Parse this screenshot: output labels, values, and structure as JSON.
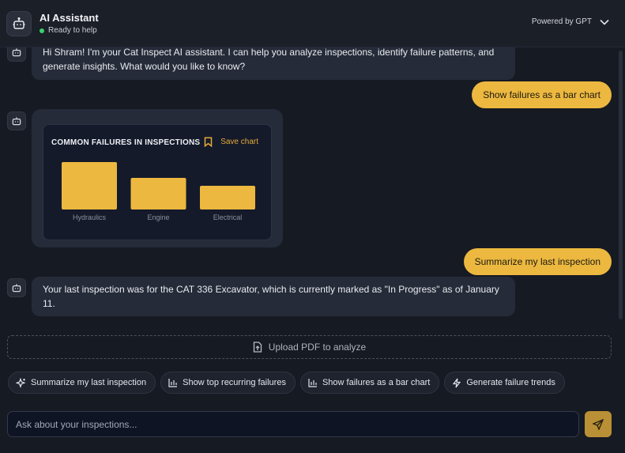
{
  "header": {
    "title": "AI Assistant",
    "status": "Ready to help",
    "powered_by": "Powered by GPT"
  },
  "messages": {
    "intro": "Hi Shram! I'm your Cat Inspect AI assistant. I can help you analyze inspections, identify failure patterns, and generate insights. What would you like to know?",
    "user_chart_request": "Show failures as a bar chart",
    "chart_title": "COMMON FAILURES IN INSPECTIONS",
    "save_chart": "Save chart",
    "user_summary_request": "Summarize my last inspection",
    "summary_reply": "Your last inspection was for the CAT 336 Excavator, which is currently marked as \"In Progress\" as of January 11."
  },
  "chart_data": {
    "type": "bar",
    "title": "COMMON FAILURES IN INSPECTIONS",
    "categories": [
      "Hydraulics",
      "Engine",
      "Electrical"
    ],
    "values": [
      6,
      4,
      3
    ],
    "ylim": [
      0,
      6
    ],
    "xlabel": "",
    "ylabel": "",
    "grid": false,
    "color": "#ecb83f"
  },
  "upload": {
    "label": "Upload PDF to analyze"
  },
  "suggestions": [
    {
      "label": "Summarize my last inspection",
      "icon": "sparkle-icon"
    },
    {
      "label": "Show top recurring failures",
      "icon": "bar-chart-icon"
    },
    {
      "label": "Show failures as a bar chart",
      "icon": "bar-chart-icon"
    },
    {
      "label": "Generate failure trends",
      "icon": "lightning-icon"
    }
  ],
  "input": {
    "placeholder": "Ask about your inspections..."
  },
  "colors": {
    "accent": "#ecb83f",
    "send_button": "#b99035",
    "status_online": "#3ccf6a",
    "background": "#161a22"
  }
}
